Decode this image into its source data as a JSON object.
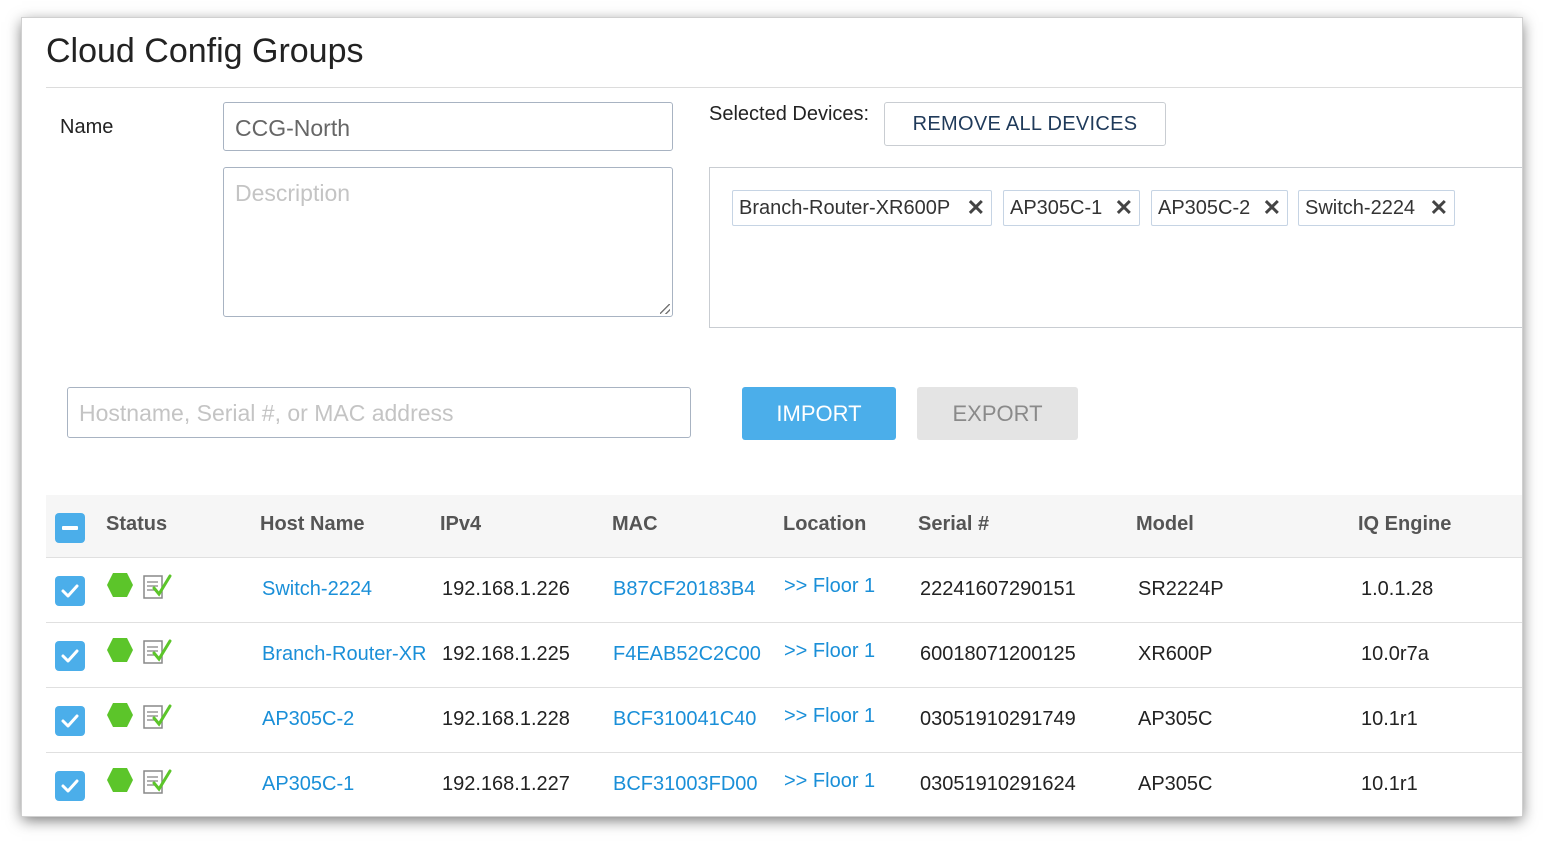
{
  "page": {
    "title": "Cloud Config Groups"
  },
  "form": {
    "name_label": "Name",
    "name_value": "CCG-North",
    "description_placeholder": "Description",
    "selected_devices_label": "Selected Devices:",
    "remove_all_label": "REMOVE ALL DEVICES",
    "selected_devices": [
      {
        "label": "Branch-Router-XR600P"
      },
      {
        "label": "AP305C-1"
      },
      {
        "label": "AP305C-2"
      },
      {
        "label": "Switch-2224"
      }
    ],
    "remove_chip_glyph": "✕"
  },
  "search": {
    "placeholder": "Hostname, Serial #, or MAC address",
    "import_label": "IMPORT",
    "export_label": "EXPORT"
  },
  "table": {
    "headers": {
      "status": "Status",
      "host_name": "Host Name",
      "ipv4": "IPv4",
      "mac": "MAC",
      "location": "Location",
      "serial": "Serial #",
      "model": "Model",
      "iq_engine": "IQ Engine"
    },
    "select_all_state": "indeterminate",
    "rows": [
      {
        "checked": true,
        "status": "online",
        "host_name": "Switch-2224",
        "ipv4": "192.168.1.226",
        "mac": "B87CF20183B4",
        "location": ">> Floor 1",
        "serial": "22241607290151",
        "model": "SR2224P",
        "iq_engine": "1.0.1.28"
      },
      {
        "checked": true,
        "status": "online",
        "host_name": "Branch-Router-XR",
        "ipv4": "192.168.1.225",
        "mac": "F4EAB52C2C00",
        "location": ">> Floor 1",
        "serial": "60018071200125",
        "model": "XR600P",
        "iq_engine": "10.0r7a"
      },
      {
        "checked": true,
        "status": "online",
        "host_name": "AP305C-2",
        "ipv4": "192.168.1.228",
        "mac": "BCF310041C40",
        "location": ">> Floor 1",
        "serial": "03051910291749",
        "model": "AP305C",
        "iq_engine": "10.1r1"
      },
      {
        "checked": true,
        "status": "online",
        "host_name": "AP305C-1",
        "ipv4": "192.168.1.227",
        "mac": "BCF31003FD00",
        "location": ">> Floor 1",
        "serial": "03051910291624",
        "model": "AP305C",
        "iq_engine": "10.1r1"
      }
    ]
  },
  "colors": {
    "accent": "#4baeea",
    "link": "#1a8fd8",
    "status_online": "#5cc52a",
    "header_bg": "#f6f6f6"
  },
  "icons": {
    "status": "hexagon-status-icon",
    "config": "config-audit-icon",
    "checkbox": "checkmark-icon"
  }
}
